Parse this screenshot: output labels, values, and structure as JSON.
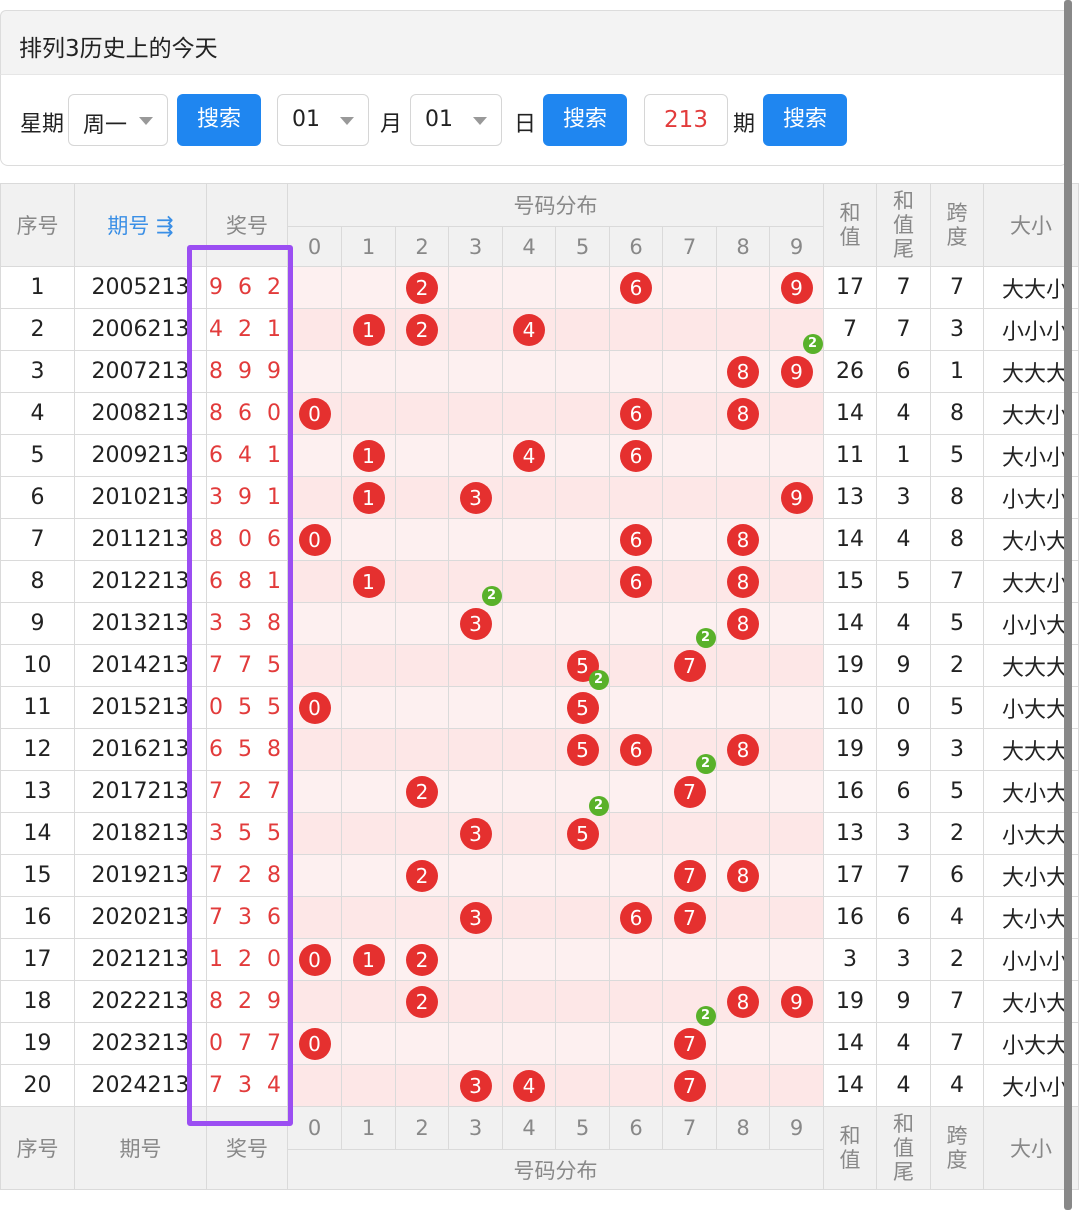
{
  "title": "排列3历史上的今天",
  "search": {
    "weekday_label": "星期",
    "weekday_value": "周一",
    "search_label": "搜索",
    "month_value": "01",
    "month_label": "月",
    "day_value": "01",
    "day_label": "日",
    "issue_value": "213",
    "issue_label": "期"
  },
  "header": {
    "seq": "序号",
    "period": "期号",
    "award": "奖号",
    "distribution": "号码分布",
    "sum": "和值",
    "sum_tail": "和值尾",
    "span": "跨度",
    "size": "大小",
    "digits": [
      "0",
      "1",
      "2",
      "3",
      "4",
      "5",
      "6",
      "7",
      "8",
      "9"
    ]
  },
  "rows": [
    {
      "seq": "1",
      "period": "2005213",
      "award": "9 6 2",
      "sum": "17",
      "tail": "7",
      "span": "7",
      "size": "大大小"
    },
    {
      "seq": "2",
      "period": "2006213",
      "award": "4 2 1",
      "sum": "7",
      "tail": "7",
      "span": "3",
      "size": "小小小"
    },
    {
      "seq": "3",
      "period": "2007213",
      "award": "8 9 9",
      "sum": "26",
      "tail": "6",
      "span": "1",
      "size": "大大大"
    },
    {
      "seq": "4",
      "period": "2008213",
      "award": "8 6 0",
      "sum": "14",
      "tail": "4",
      "span": "8",
      "size": "大大小"
    },
    {
      "seq": "5",
      "period": "2009213",
      "award": "6 4 1",
      "sum": "11",
      "tail": "1",
      "span": "5",
      "size": "大小小"
    },
    {
      "seq": "6",
      "period": "2010213",
      "award": "3 9 1",
      "sum": "13",
      "tail": "3",
      "span": "8",
      "size": "小大小"
    },
    {
      "seq": "7",
      "period": "2011213",
      "award": "8 0 6",
      "sum": "14",
      "tail": "4",
      "span": "8",
      "size": "大小大"
    },
    {
      "seq": "8",
      "period": "2012213",
      "award": "6 8 1",
      "sum": "15",
      "tail": "5",
      "span": "7",
      "size": "大大小"
    },
    {
      "seq": "9",
      "period": "2013213",
      "award": "3 3 8",
      "sum": "14",
      "tail": "4",
      "span": "5",
      "size": "小小大"
    },
    {
      "seq": "10",
      "period": "2014213",
      "award": "7 7 5",
      "sum": "19",
      "tail": "9",
      "span": "2",
      "size": "大大大"
    },
    {
      "seq": "11",
      "period": "2015213",
      "award": "0 5 5",
      "sum": "10",
      "tail": "0",
      "span": "5",
      "size": "小大大"
    },
    {
      "seq": "12",
      "period": "2016213",
      "award": "6 5 8",
      "sum": "19",
      "tail": "9",
      "span": "3",
      "size": "大大大"
    },
    {
      "seq": "13",
      "period": "2017213",
      "award": "7 2 7",
      "sum": "16",
      "tail": "6",
      "span": "5",
      "size": "大小大"
    },
    {
      "seq": "14",
      "period": "2018213",
      "award": "3 5 5",
      "sum": "13",
      "tail": "3",
      "span": "2",
      "size": "小大大"
    },
    {
      "seq": "15",
      "period": "2019213",
      "award": "7 2 8",
      "sum": "17",
      "tail": "7",
      "span": "6",
      "size": "大小大"
    },
    {
      "seq": "16",
      "period": "2020213",
      "award": "7 3 6",
      "sum": "16",
      "tail": "6",
      "span": "4",
      "size": "大小大"
    },
    {
      "seq": "17",
      "period": "2021213",
      "award": "1 2 0",
      "sum": "3",
      "tail": "3",
      "span": "2",
      "size": "小小小"
    },
    {
      "seq": "18",
      "period": "2022213",
      "award": "8 2 9",
      "sum": "19",
      "tail": "9",
      "span": "7",
      "size": "大小大"
    },
    {
      "seq": "19",
      "period": "2023213",
      "award": "0 7 7",
      "sum": "14",
      "tail": "4",
      "span": "7",
      "size": "小大大"
    },
    {
      "seq": "20",
      "period": "2024213",
      "award": "7 3 4",
      "sum": "14",
      "tail": "4",
      "span": "4",
      "size": "大小小"
    }
  ]
}
